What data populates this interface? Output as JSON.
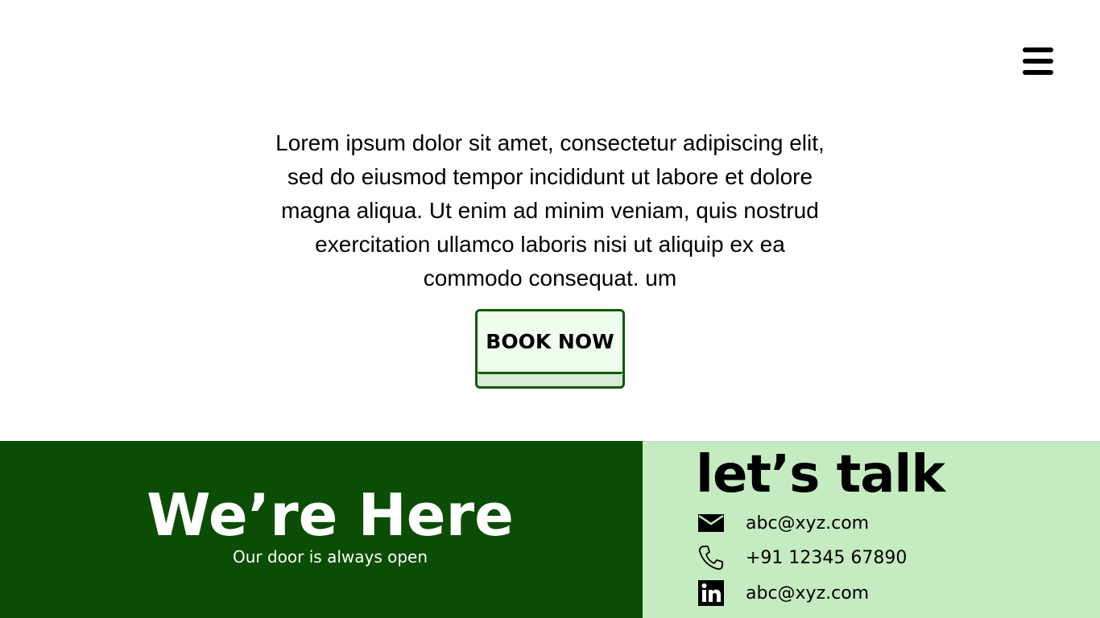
{
  "header": {
    "menu_icon": "hamburger-menu-icon"
  },
  "hero": {
    "text": "Lorem ipsum dolor sit amet, consectetur adipiscing elit, sed do eiusmod tempor incididunt ut labore et dolore magna aliqua. Ut enim ad minim veniam, quis nostrud exercitation ullamco laboris nisi ut aliquip ex ea commodo consequat. um",
    "button_label": "BOOK NOW"
  },
  "footer": {
    "left": {
      "title": "We’re Here",
      "subtitle": "Our door is always open",
      "background": "#0b4d04"
    },
    "right": {
      "title": "let’s talk",
      "background": "#c5ebc1",
      "contacts": [
        {
          "icon": "mail-icon",
          "text": "abc@xyz.com"
        },
        {
          "icon": "phone-icon",
          "text": "+91 12345 67890"
        },
        {
          "icon": "linkedin-icon",
          "text": "abc@xyz.com"
        }
      ]
    }
  },
  "colors": {
    "accent_dark_green": "#0d5a08",
    "button_face": "#effeec"
  }
}
